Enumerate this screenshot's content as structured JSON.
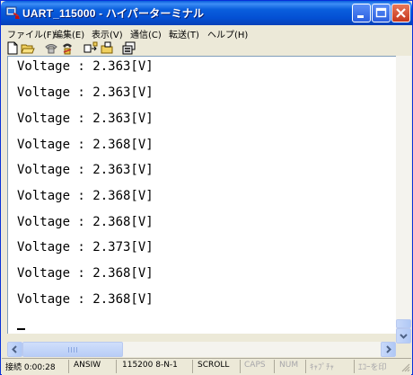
{
  "window": {
    "title": "UART_115000 - ハイパーターミナル",
    "icons": {
      "app": "phone-terminal-icon",
      "minimize": "minimize-icon",
      "maximize": "maximize-icon",
      "close": "close-icon"
    }
  },
  "menu": {
    "items": [
      {
        "label": "ファイル(F)"
      },
      {
        "label": "編集(E)"
      },
      {
        "label": "表示(V)"
      },
      {
        "label": "通信(C)"
      },
      {
        "label": "転送(T)"
      },
      {
        "label": "ヘルプ(H)"
      }
    ]
  },
  "toolbar": {
    "icons": [
      "new-document-icon",
      "open-folder-icon",
      "call-icon",
      "disconnect-icon",
      "send-icon",
      "receive-icon",
      "properties-icon"
    ]
  },
  "terminal": {
    "lines": [
      "Voltage : 2.363[V]",
      "Voltage : 2.363[V]",
      "Voltage : 2.363[V]",
      "Voltage : 2.368[V]",
      "Voltage : 2.363[V]",
      "Voltage : 2.368[V]",
      "Voltage : 2.368[V]",
      "Voltage : 2.373[V]",
      "Voltage : 2.368[V]",
      "Voltage : 2.368[V]"
    ]
  },
  "statusbar": {
    "connection": "接続 0:00:28",
    "emulation": "ANSIW",
    "settings": "115200 8-N-1",
    "scroll": "SCROLL",
    "caps": "CAPS",
    "num": "NUM",
    "capture": "ｷｬﾌﾟﾁｬ",
    "echo": "ｴｺｰを印"
  },
  "colors": {
    "titlebar": "#0A5FDD",
    "chrome": "#ECE9D8",
    "close_button": "#C6361B"
  }
}
